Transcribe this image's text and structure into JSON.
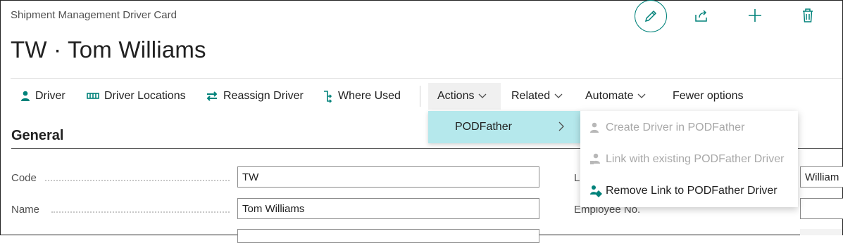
{
  "page": {
    "caption": "Shipment Management Driver Card",
    "title": "TW · Tom Williams"
  },
  "header_actions": [
    "pencil-icon",
    "share-icon",
    "plus-icon",
    "trash-icon"
  ],
  "ribbon": {
    "driver": "Driver",
    "driver_locations": "Driver Locations",
    "reassign_driver": "Reassign Driver",
    "where_used": "Where Used",
    "actions": "Actions",
    "related": "Related",
    "automate": "Automate",
    "fewer_options": "Fewer options"
  },
  "section": {
    "general": "General"
  },
  "fields": {
    "code_label": "Code",
    "code_value": "TW",
    "name_label": "Name",
    "name_value": "Tom Williams",
    "last_name_label": "La",
    "last_name_value": "William",
    "employee_no_label": "Employee No."
  },
  "menu": {
    "submenu_label": "PODFather",
    "items": [
      {
        "label": "Create Driver in PODFather",
        "enabled": false
      },
      {
        "label": "Link with existing PODFather Driver",
        "enabled": false
      },
      {
        "label": "Remove Link to PODFather Driver",
        "enabled": true
      }
    ]
  },
  "colors": {
    "accent": "#00827a",
    "submenu_highlight": "#b5e8ec",
    "disabled_text": "#a8a8a8"
  }
}
